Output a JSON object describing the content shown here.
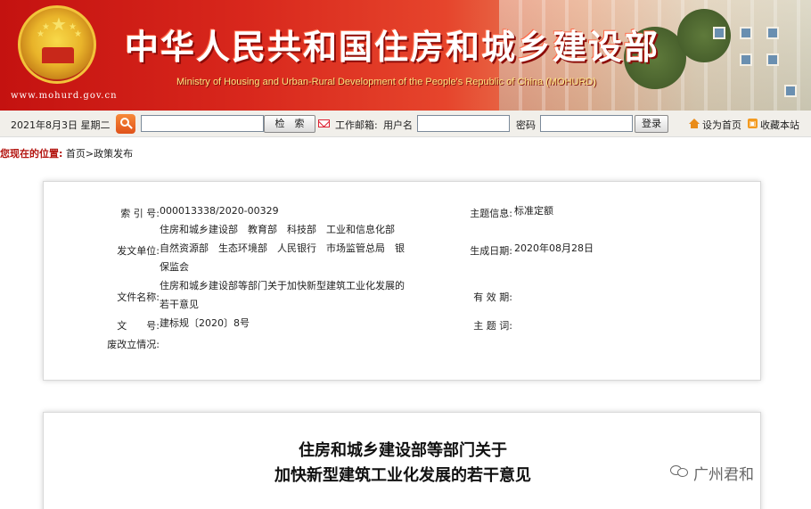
{
  "header": {
    "site_title": "中华人民共和国住房和城乡建设部",
    "site_subtitle": "Ministry of Housing and Urban-Rural Development of the People's Republic of China (MOHURD)",
    "site_url": "www.mohurd.gov.cn"
  },
  "toolbar": {
    "date": "2021年8月3日 星期二",
    "search_button": "检　索",
    "mail_label": "工作邮箱:",
    "username_label": "用户名",
    "password_label": "密码",
    "login_button": "登录",
    "set_home": "设为首页",
    "add_favorite": "收藏本站"
  },
  "breadcrumb": {
    "here": "您现在的位置:",
    "home": "首页",
    "separator": ">",
    "section": "政策发布"
  },
  "info": {
    "index_label": "索 引 号:",
    "index_value": "000013338/2020-00329",
    "topic_label": "主题信息:",
    "topic_value": "标准定额",
    "issuer_label": "发文单位:",
    "issuer_line1": "住房和城乡建设部　教育部　科技部　工业和信息化部",
    "issuer_line2": "自然资源部　生态环境部　人民银行　市场监管总局　银",
    "issuer_line3": "保监会",
    "date_label": "生成日期:",
    "date_value": "2020年08月28日",
    "name_label": "文件名称:",
    "name_line1": "住房和城乡建设部等部门关于加快新型建筑工业化发展的",
    "name_line2": "若干意见",
    "validity_label": "有 效 期:",
    "validity_value": "",
    "docno_label": "文　　号:",
    "docno_value": "建标规〔2020〕8号",
    "keyword_label": "主 题 词:",
    "keyword_value": "",
    "status_label": "废改立情况:",
    "status_value": ""
  },
  "article": {
    "title_line1": "住房和城乡建设部等部门关于",
    "title_line2": "加快新型建筑工业化发展的若干意见"
  },
  "watermark": {
    "text": "广州君和"
  },
  "colors": {
    "banner_red": "#c41210",
    "breadcrumb_red": "#b3140f",
    "search_orange": "#e0521a"
  }
}
